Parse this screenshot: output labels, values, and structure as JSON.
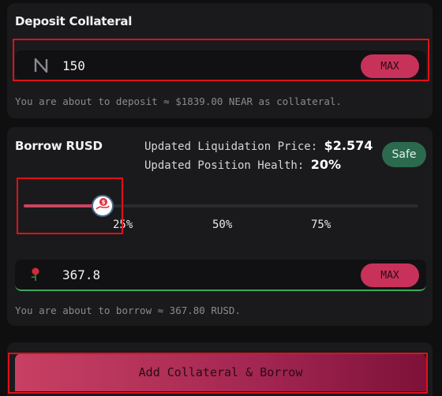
{
  "deposit": {
    "title": "Deposit Collateral",
    "input_value": "150",
    "max_label": "MAX",
    "helper_text": "You are about to deposit ≈ $1839.00 NEAR as collateral."
  },
  "borrow": {
    "title": "Borrow RUSD",
    "liq_label": "Updated Liquidation Price:",
    "liq_value": "$2.574",
    "health_label": "Updated Position Health:",
    "health_value": "20%",
    "badge": "Safe",
    "slider": {
      "value_fraction": 0.2,
      "ticks": [
        "25%",
        "50%",
        "75%"
      ]
    },
    "input_value": "367.8",
    "max_label": "MAX",
    "helper_text": "You are about to borrow ≈ 367.80 RUSD."
  },
  "action": {
    "button_label": "Add Collateral & Borrow"
  },
  "colors": {
    "accent": "#c8325a",
    "safe": "#2b6a4c",
    "highlight": "#e0101a"
  }
}
